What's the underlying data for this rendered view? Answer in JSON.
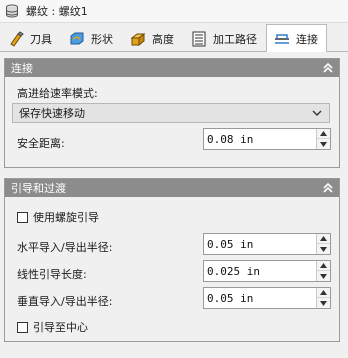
{
  "title": {
    "text": "螺纹 : 螺纹1",
    "icon": "thread-stack-icon"
  },
  "tabs": [
    {
      "label": "刀具",
      "icon": "tool-icon",
      "active": false
    },
    {
      "label": "形状",
      "icon": "shape-icon",
      "active": false
    },
    {
      "label": "高度",
      "icon": "height-icon",
      "active": false
    },
    {
      "label": "加工路径",
      "icon": "passes-icon",
      "active": false
    },
    {
      "label": "连接",
      "icon": "linking-icon",
      "active": true
    }
  ],
  "linking": {
    "header": "连接",
    "feed_mode_label": "高进给速率模式:",
    "feed_mode_value": "保存快速移动",
    "safe_distance_label": "安全距离:",
    "safe_distance_value": "0.08 in"
  },
  "leads": {
    "header": "引导和过渡",
    "helical_label": "使用螺旋引导",
    "helical_checked": false,
    "horiz_label": "水平导入/导出半径:",
    "horiz_value": "0.05 in",
    "linear_label": "线性引导长度:",
    "linear_value": "0.025 in",
    "vert_label": "垂直导入/导出半径:",
    "vert_value": "0.05 in",
    "center_label": "引导至中心",
    "center_checked": false
  },
  "colors": {
    "header_bg": "#8c8c8c",
    "panel_bg": "#f0f0f0",
    "accent_blue": "#2f7fd1"
  }
}
